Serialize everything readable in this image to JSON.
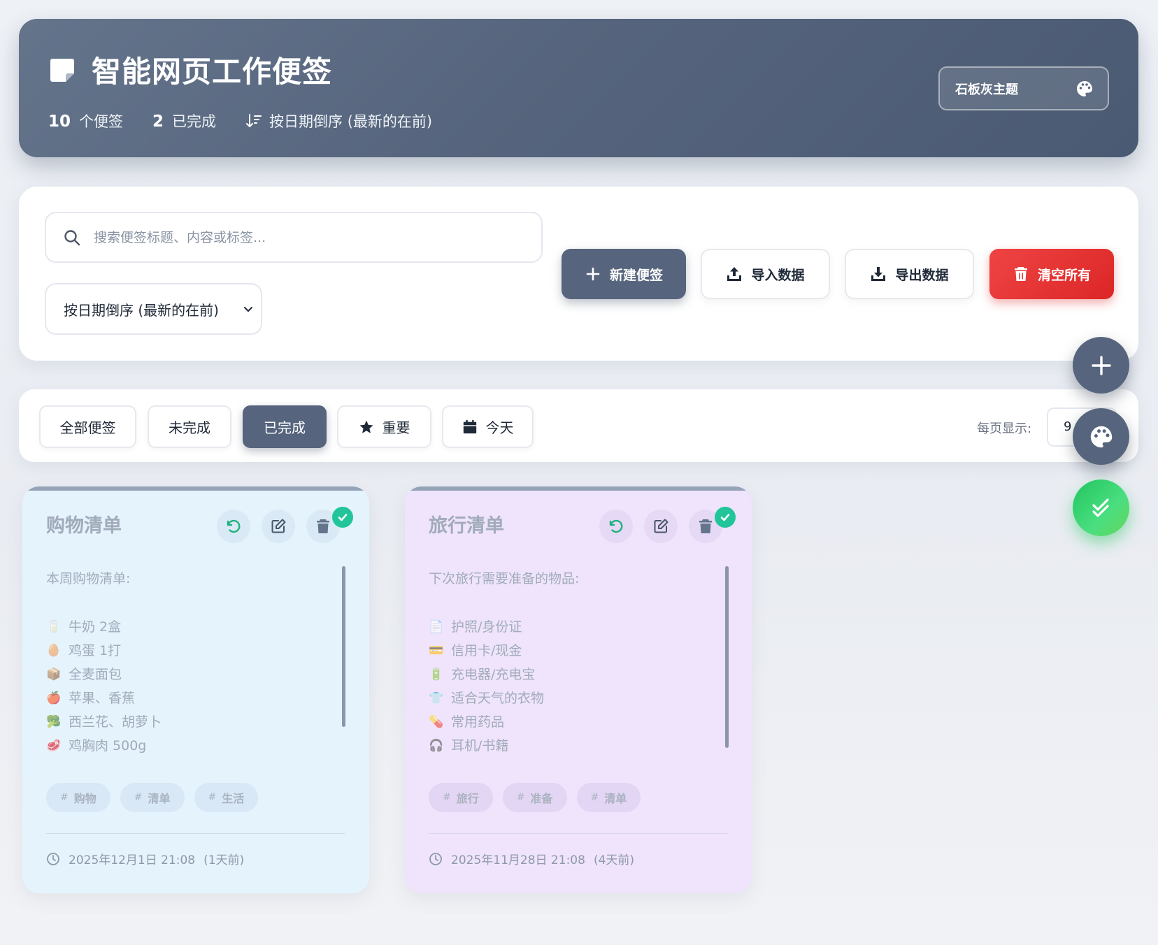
{
  "header": {
    "title": "智能网页工作便签",
    "stats": [
      {
        "value": "10",
        "label": "个便签"
      },
      {
        "value": "2",
        "label": "已完成"
      }
    ],
    "sort_info": "按日期倒序 (最新的在前)",
    "theme_button": "石板灰主题"
  },
  "toolbar": {
    "search_placeholder": "搜索便签标题、内容或标签...",
    "sort_select": "按日期倒序 (最新的在前)",
    "new_note": "新建便签",
    "import": "导入数据",
    "export": "导出数据",
    "clear_all": "清空所有"
  },
  "filters": {
    "all": "全部便签",
    "todo": "未完成",
    "done": "已完成",
    "important": "重要",
    "today": "今天",
    "active": "已完成",
    "per_page_label": "每页显示:",
    "per_page_value": "9"
  },
  "notes": [
    {
      "title": "购物清单",
      "intro": "本周购物清单:",
      "items": [
        {
          "emoji": "🥛",
          "text": "牛奶 2盒"
        },
        {
          "emoji": "🥚",
          "text": "鸡蛋 1打"
        },
        {
          "emoji": "📦",
          "text": "全麦面包"
        },
        {
          "emoji": "🍎",
          "text": "苹果、香蕉"
        },
        {
          "emoji": "🥦",
          "text": "西兰花、胡萝卜"
        },
        {
          "emoji": "🥩",
          "text": "鸡胸肉 500g"
        }
      ],
      "tags": [
        "购物",
        "清单",
        "生活"
      ],
      "date": "2025年12月1日 21:08",
      "relative": "(1天前)",
      "completed": true
    },
    {
      "title": "旅行清单",
      "intro": "下次旅行需要准备的物品:",
      "items": [
        {
          "emoji": "📄",
          "text": "护照/身份证"
        },
        {
          "emoji": "💳",
          "text": "信用卡/现金"
        },
        {
          "emoji": "🔋",
          "text": "充电器/充电宝"
        },
        {
          "emoji": "👕",
          "text": "适合天气的衣物"
        },
        {
          "emoji": "💊",
          "text": "常用药品"
        },
        {
          "emoji": "🎧",
          "text": "耳机/书籍"
        }
      ],
      "tags": [
        "旅行",
        "准备",
        "清单"
      ],
      "date": "2025年11月28日 21:08",
      "relative": "(4天前)",
      "completed": true
    }
  ],
  "colors": {
    "header_bg": "#56657d",
    "primary": "#56657d",
    "danger": "#ef4444",
    "success": "#22c55e",
    "card_blue": "#e5f3fd",
    "card_purple": "#efe4fb"
  },
  "icons": {
    "title": "sticky-note-icon",
    "sort": "sort-desc-icon",
    "theme": "palette-icon",
    "search": "search-icon",
    "new": "plus-icon",
    "import": "upload-icon",
    "export": "download-icon",
    "clear": "trash-icon",
    "important": "star-icon",
    "today": "calendar-icon",
    "fab_add": "plus-icon",
    "fab_theme": "palette-icon",
    "fab_done": "double-check-icon",
    "note_undo": "undo-icon",
    "note_edit": "edit-icon",
    "note_delete": "trash-icon",
    "note_done": "check-icon",
    "note_time": "clock-icon"
  }
}
